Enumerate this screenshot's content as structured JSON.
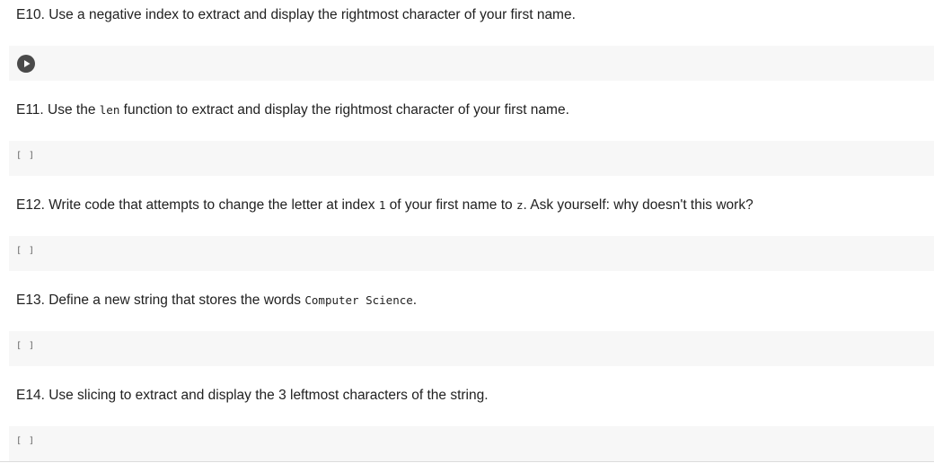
{
  "cells": [
    {
      "text_parts": [
        "E10. Use a negative index to extract and display the rightmost character of your first name."
      ],
      "code_prompt": null
    },
    {
      "text_parts": [
        "E11. Use the ",
        "len",
        " function to extract and display the rightmost character of your first name."
      ],
      "code_prompt": "[ ]"
    },
    {
      "text_parts": [
        "E12. Write code that attempts to change the letter at index ",
        "1",
        " of your first name to ",
        "z",
        ". Ask yourself: why doesn't this work?"
      ],
      "code_prompt": "[ ]"
    },
    {
      "text_parts": [
        "E13. Define a new string that stores the words ",
        "Computer Science",
        "."
      ],
      "code_prompt": "[ ]"
    },
    {
      "text_parts": [
        "E14. Use slicing to extract and display the 3 leftmost characters of the string."
      ],
      "code_prompt": "[ ]"
    }
  ],
  "icons": {
    "run": "play-circle-icon"
  }
}
